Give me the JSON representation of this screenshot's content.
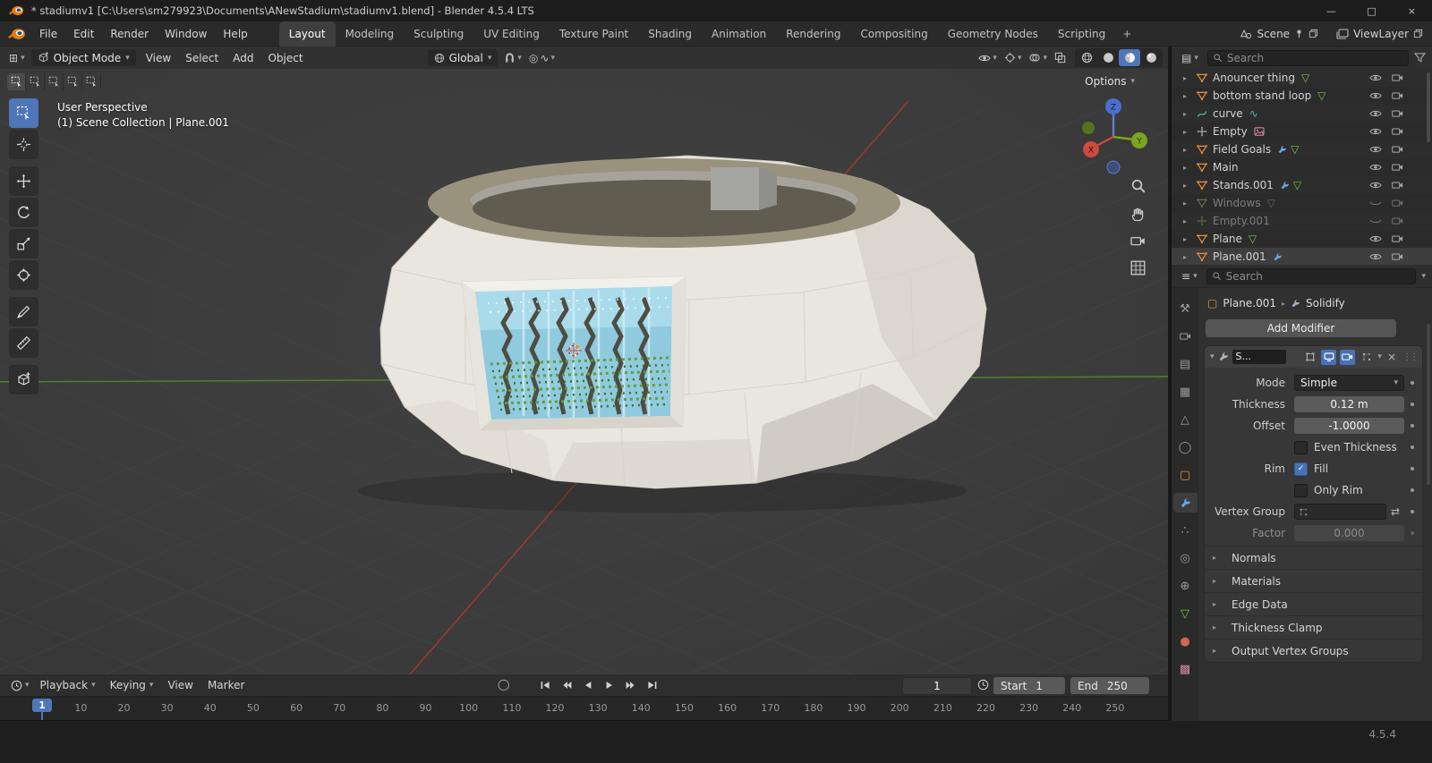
{
  "icons": {
    "dropdown": "▾",
    "expand": "▸",
    "minimize": "—",
    "maximize": "□",
    "close": "×",
    "check": "✓",
    "times_small": "×",
    "drag": "⋮⋮",
    "swap": "⇄",
    "editor": "⊞",
    "outliner_list": "▤",
    "properties_list": "≡",
    "prop_edit": "◎",
    "falloff": "∿",
    "autokey": "◯",
    "mesh_tri": "▽",
    "curve_wave": "∿",
    "tab_tool": "⚒",
    "tab_output": "▤",
    "tab_viewlayer": "▦",
    "tab_scene": "△",
    "tab_world": "◯",
    "tab_object": "▢",
    "tab_particles": "∴",
    "tab_physics": "◎",
    "tab_constraints": "⊕",
    "tab_data": "▽",
    "tab_material": "●",
    "tab_texture": "▩"
  },
  "titlebar": {
    "title": "* stadiumv1 [C:\\Users\\sm279923\\Documents\\ANewStadium\\stadiumv1.blend] - Blender 4.5.4 LTS"
  },
  "menubar": {
    "items": [
      "File",
      "Edit",
      "Render",
      "Window",
      "Help"
    ]
  },
  "workspaces": {
    "tabs": [
      "Layout",
      "Modeling",
      "Sculpting",
      "UV Editing",
      "Texture Paint",
      "Shading",
      "Animation",
      "Rendering",
      "Compositing",
      "Geometry Nodes",
      "Scripting"
    ],
    "add_tab": "+"
  },
  "scene_widget": {
    "scene": "Scene",
    "view_layer": "ViewLayer"
  },
  "viewport_header": {
    "mode": "Object Mode",
    "menus": [
      "View",
      "Select",
      "Add",
      "Object"
    ],
    "orientation": "Global"
  },
  "viewport": {
    "perspective": "User Perspective",
    "breadcrumb": "(1) Scene Collection | Plane.001",
    "options": "Options",
    "axis_x": "X",
    "axis_y": "Y",
    "axis_z": "Z"
  },
  "outliner": {
    "search_placeholder": "Search",
    "items": [
      {
        "label": "Anouncer thing"
      },
      {
        "label": "bottom stand loop"
      },
      {
        "label": "curve"
      },
      {
        "label": "Empty"
      },
      {
        "label": "Field Goals"
      },
      {
        "label": "Main"
      },
      {
        "label": "Stands.001"
      },
      {
        "label": "Windows"
      },
      {
        "label": "Empty.001"
      },
      {
        "label": "Plane"
      },
      {
        "label": "Plane.001"
      }
    ]
  },
  "properties": {
    "search_placeholder": "Search",
    "breadcrumb_object": "Plane.001",
    "breadcrumb_modifier": "Solidify",
    "add_modifier_label": "Add Modifier",
    "modifier": {
      "name": "S...",
      "mode_label": "Mode",
      "mode_value": "Simple",
      "thickness_label": "Thickness",
      "thickness_value": "0.12 m",
      "offset_label": "Offset",
      "offset_value": "-1.0000",
      "even_thickness_label": "Even Thickness",
      "rim_label": "Rim",
      "fill_label": "Fill",
      "only_rim_label": "Only Rim",
      "vertex_group_label": "Vertex Group",
      "factor_label": "Factor",
      "factor_value": "0.000",
      "sections": [
        "Normals",
        "Materials",
        "Edge Data",
        "Thickness Clamp",
        "Output Vertex Groups"
      ]
    }
  },
  "timeline": {
    "menus": [
      "Playback",
      "Keying",
      "View",
      "Marker"
    ],
    "current_frame": "1",
    "start_label": "Start",
    "start_value": "1",
    "end_label": "End",
    "end_value": "250",
    "playhead": "1",
    "ticks": [
      1,
      10,
      20,
      30,
      40,
      50,
      60,
      70,
      80,
      90,
      100,
      110,
      120,
      130,
      140,
      150,
      160,
      170,
      180,
      190,
      200,
      210,
      220,
      230,
      240,
      250
    ]
  },
  "statusbar": {
    "version": "4.5.4"
  }
}
